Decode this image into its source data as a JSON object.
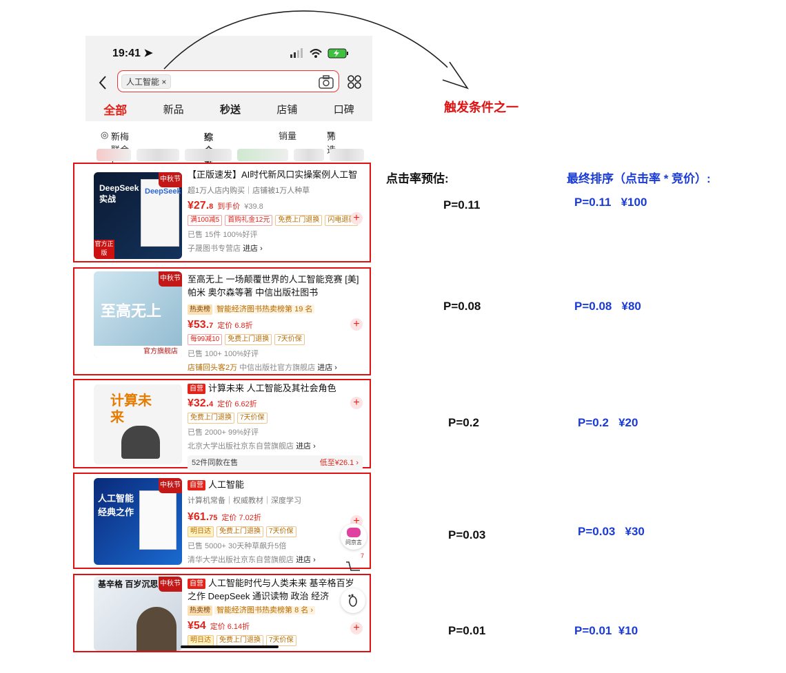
{
  "status_bar": {
    "time": "19:41"
  },
  "search": {
    "chip": "人工智能"
  },
  "tabs": [
    "全部",
    "新品",
    "秒送",
    "店铺",
    "口碑"
  ],
  "filters": {
    "location": "新梅联合广…",
    "sort": "综合推荐",
    "sales": "销量",
    "filter": "筛选"
  },
  "products": [
    {
      "title": "【正版速发】AI时代新风口实操案例人工智",
      "meta": "超1万人店内购买｜店铺被1万人种草",
      "price_int": "¥27.",
      "price_dec": "8",
      "price_tag": "到手价",
      "old_price": "¥39.8",
      "badges": [
        "满100减5",
        "首购礼金12元",
        "免费上门退换",
        "闪电退款"
      ],
      "sold": "已售 15件  100%好评",
      "shop": "子晟图书专营店",
      "enter": "进店 ›",
      "badge_fest": "中秋节",
      "thumb_text": "DeepSeek实战",
      "thumb_corner": "官方正版"
    },
    {
      "title": "至高无上 一场颠覆世界的人工智能竞赛 [美] 帕米 奥尔森等著 中信出版社图书",
      "hot_label": "热卖榜",
      "rank": "智能经济图书热卖榜第 19 名",
      "price_int": "¥53.",
      "price_dec": "7",
      "price_tag": "定价 6.8折",
      "badges": [
        "每99减10",
        "免费上门退换",
        "7天价保"
      ],
      "sold": "已售 100+  100%好评",
      "shop_extra": "店铺回头客2万",
      "shop": "中信出版社官方旗舰店",
      "enter": "进店 ›",
      "badge_fest": "中秋节",
      "thumb_text": "至高无上",
      "thumb_corner": "官方旗舰店"
    },
    {
      "selfop": "自营",
      "title": "计算未来 人工智能及其社会角色",
      "price_int": "¥32.",
      "price_dec": "4",
      "price_tag": "定价 6.62折",
      "badges": [
        "免费上门退换",
        "7天价保"
      ],
      "sold": "已售 2000+  99%好评",
      "shop": "北京大学出版社京东自营旗舰店",
      "enter": "进店 ›",
      "bottom_left": "52件同款在售",
      "bottom_right": "低至¥26.1 ›",
      "thumb_text": "计算未来"
    },
    {
      "selfop": "自营",
      "title": "人工智能",
      "meta": "计算机常备｜权威教材｜深度学习",
      "price_int": "¥61.",
      "price_dec": "75",
      "price_tag": "定价 7.02折",
      "badges": [
        "明日达",
        "免费上门退换",
        "7天价保"
      ],
      "sold": "已售 5000+  30天种草飙升5倍",
      "shop": "清华大学出版社京东自营旗舰店",
      "enter": "进店 ›",
      "badge_fest": "中秋节",
      "thumb_text": "人工智能 经典之作"
    },
    {
      "selfop": "自营",
      "title": "人工智能时代与人类未来 基辛格百岁之作 DeepSeek 通识读物 政治 经济",
      "hot_label": "热卖榜",
      "rank": "智能经济图书热卖榜第 8 名 ›",
      "price_int": "¥54",
      "price_dec": "",
      "price_tag": "定价 6.14折",
      "badges": [
        "明日达",
        "免费上门退换",
        "7天价保"
      ],
      "badge_fest": "中秋节",
      "thumb_text": "基辛格 百岁沉思"
    }
  ],
  "float_buttons": {
    "ask": "问京言",
    "cart_count": "7"
  },
  "annotations": {
    "trigger": "触发条件之一",
    "ctr_heading": "点击率预估:",
    "rank_heading": "最终排序（点击率 * 竞价）:",
    "ctr_values": [
      "P=0.11",
      "P=0.08",
      "P=0.2",
      "P=0.03",
      "P=0.01"
    ],
    "rank_values": [
      "P=0.11   ¥100",
      "P=0.08   ¥80",
      "P=0.2   ¥20",
      "P=0.03   ¥30",
      "P=0.01  ¥10"
    ]
  },
  "colors": {
    "accent": "#e2231a",
    "annotation_blue": "#1a3ad6",
    "box_red": "#e01010"
  }
}
